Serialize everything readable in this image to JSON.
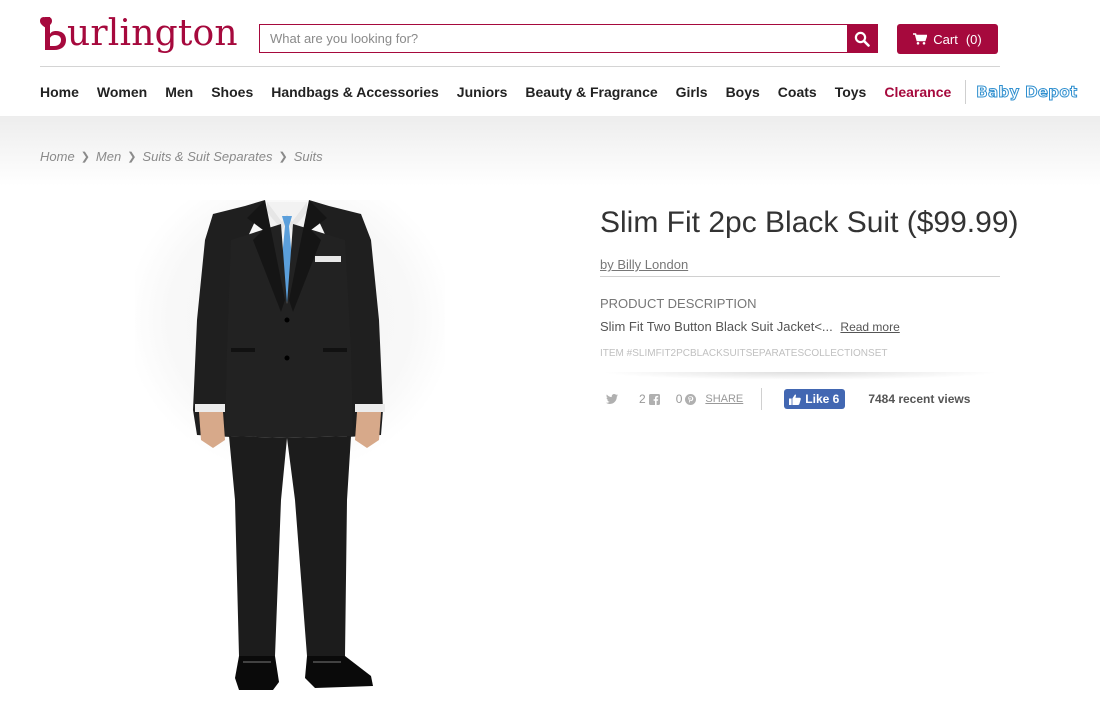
{
  "brand": {
    "logo_text": "urlington",
    "accent_color": "#a6093d"
  },
  "search": {
    "placeholder": "What are you looking for?"
  },
  "cart": {
    "label": "Cart",
    "count": "(0)"
  },
  "nav": {
    "items": [
      "Home",
      "Women",
      "Men",
      "Shoes",
      "Handbags & Accessories",
      "Juniors",
      "Beauty & Fragrance",
      "Girls",
      "Boys",
      "Coats",
      "Toys",
      "Clearance"
    ],
    "baby_depot": "Baby Depot"
  },
  "breadcrumb": [
    "Home",
    "Men",
    "Suits & Suit Separates",
    "Suits"
  ],
  "product": {
    "title": "Slim Fit 2pc Black Suit ($99.99)",
    "brand": "by Billy London",
    "description_heading": "PRODUCT DESCRIPTION",
    "description": "Slim Fit Two Button Black Suit Jacket<...",
    "read_more": "Read more",
    "item_number": "ITEM #SLIMFIT2PCBLACKSUITSEPARATESCOLLECTIONSET"
  },
  "social": {
    "twitter_icon": "twitter-icon",
    "facebook_count": "2",
    "pinterest_count": "0",
    "share_label": "SHARE",
    "like_label": "Like 6",
    "recent_views": "7484 recent views"
  }
}
